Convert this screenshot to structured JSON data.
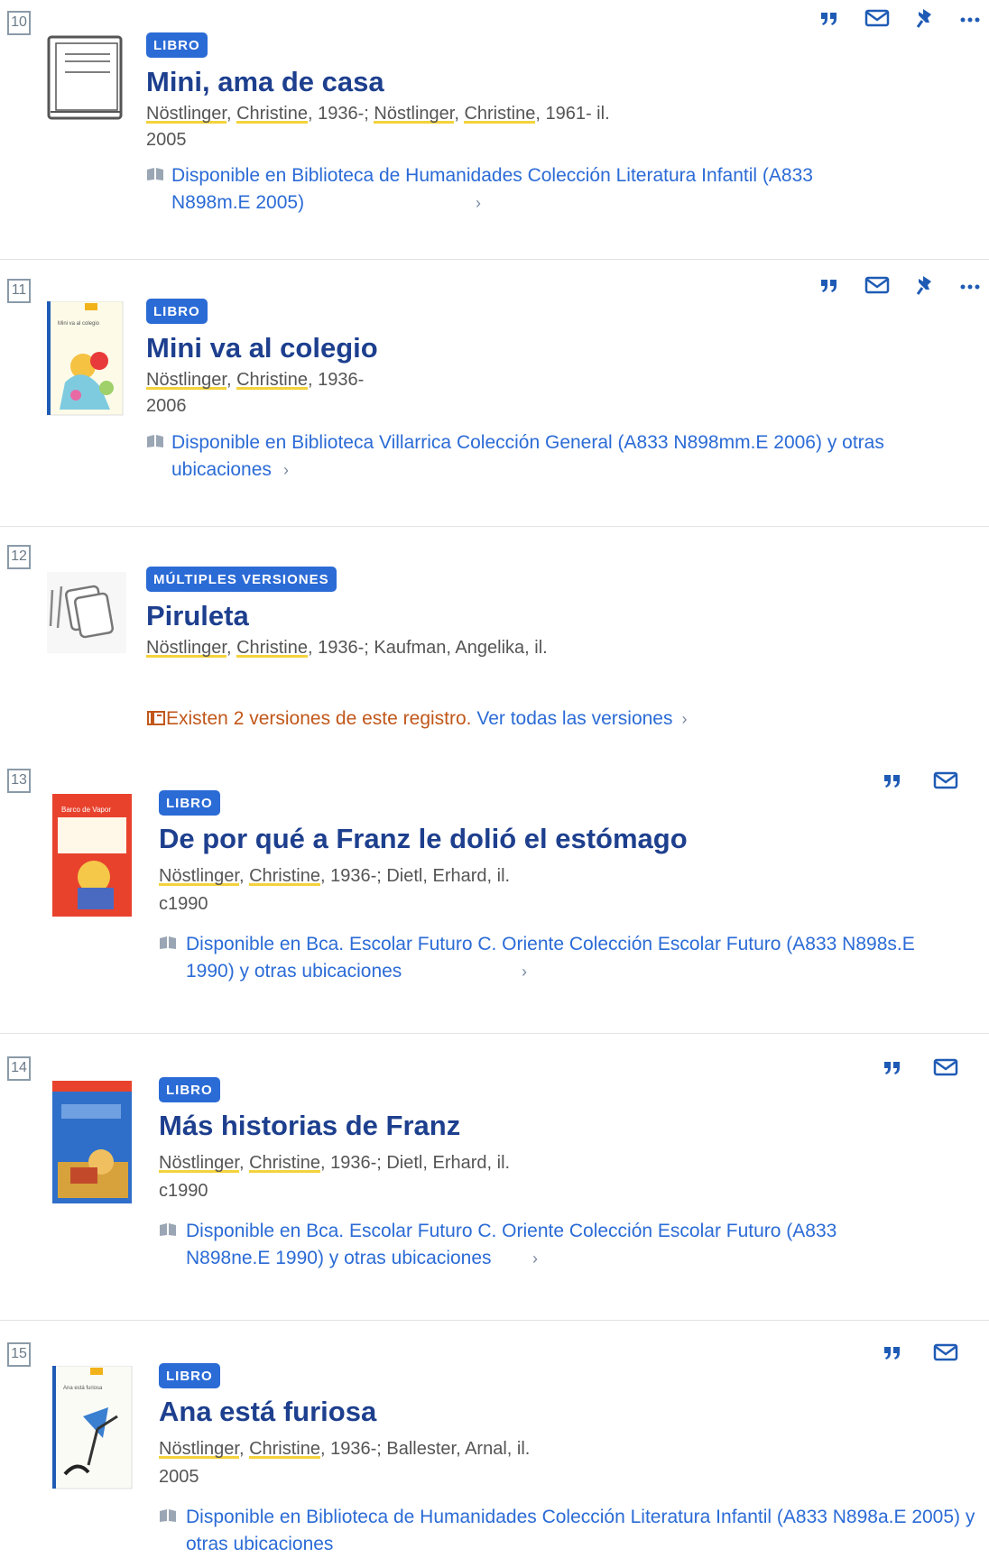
{
  "records": [
    {
      "number": "10",
      "badge": "LIBRO",
      "title": "Mini, ama de casa",
      "authors": [
        {
          "hl": "Nöstlinger"
        },
        {
          "t": ", "
        },
        {
          "hl": "Christine"
        },
        {
          "t": ", 1936-; "
        },
        {
          "hl": "Nöstlinger"
        },
        {
          "t": ", "
        },
        {
          "hl": "Christine"
        },
        {
          "t": ", 1961- il."
        }
      ],
      "date": "2005",
      "availability": "Disponible en Biblioteca de Humanidades  Colección Literatura Infantil (A833 N898m.E 2005)",
      "actions": [
        "quote-icon",
        "email-icon",
        "pin-icon",
        "more-icon"
      ]
    },
    {
      "number": "11",
      "badge": "LIBRO",
      "title": "Mini va al colegio",
      "authors": [
        {
          "hl": "Nöstlinger"
        },
        {
          "t": ", "
        },
        {
          "hl": "Christine"
        },
        {
          "t": ", 1936-"
        }
      ],
      "date": "2006",
      "availability": "Disponible en Biblioteca Villarrica  Colección General (A833 N898mm.E 2006) y otras ubicaciones",
      "actions": [
        "quote-icon",
        "email-icon",
        "pin-icon",
        "more-icon"
      ]
    },
    {
      "number": "12",
      "badge": "MÚLTIPLES VERSIONES",
      "title": "Piruleta",
      "authors": [
        {
          "hl": "Nöstlinger"
        },
        {
          "t": ", "
        },
        {
          "hl": "Christine"
        },
        {
          "t": ", 1936-; Kaufman, Angelika, il."
        }
      ],
      "versions_text": "Existen 2 versiones de este registro.",
      "versions_link": "Ver todas las versiones"
    },
    {
      "number": "13",
      "badge": "LIBRO",
      "title": "De por qué a Franz le dolió el estómago",
      "authors": [
        {
          "hl": "Nöstlinger"
        },
        {
          "t": ", "
        },
        {
          "hl": "Christine"
        },
        {
          "t": ", 1936-; Dietl, Erhard, il."
        }
      ],
      "date": "c1990",
      "availability": "Disponible en Bca. Escolar Futuro C. Oriente  Colección Escolar Futuro (A833 N898s.E 1990) y otras ubicaciones",
      "actions": [
        "quote-icon",
        "email-icon"
      ]
    },
    {
      "number": "14",
      "badge": "LIBRO",
      "title": "Más historias de Franz",
      "authors": [
        {
          "hl": "Nöstlinger"
        },
        {
          "t": ", "
        },
        {
          "hl": "Christine"
        },
        {
          "t": ", 1936-; Dietl, Erhard, il."
        }
      ],
      "date": "c1990",
      "availability": "Disponible en Bca. Escolar Futuro C. Oriente  Colección Escolar Futuro (A833 N898ne.E 1990) y otras ubicaciones",
      "actions": [
        "quote-icon",
        "email-icon"
      ]
    },
    {
      "number": "15",
      "badge": "LIBRO",
      "title": "Ana está furiosa",
      "authors": [
        {
          "hl": "Nöstlinger"
        },
        {
          "t": ", "
        },
        {
          "hl": "Christine"
        },
        {
          "t": ", 1936-; Ballester, Arnal, il."
        }
      ],
      "date": "2005",
      "availability": "Disponible en Biblioteca de Humanidades  Colección Literatura Infantil (A833 N898a.E 2005) y otras ubicaciones",
      "actions": [
        "quote-icon",
        "email-icon"
      ]
    }
  ],
  "colors": {
    "badge": "#2b6bd6",
    "title": "#1d3f8e",
    "link": "#2b6bd6",
    "highlight": "#f4d23c",
    "warning": "#c1571a"
  }
}
